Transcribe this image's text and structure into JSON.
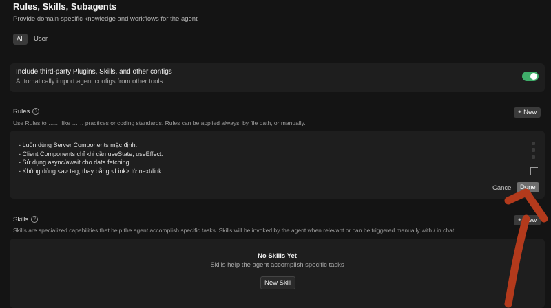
{
  "header": {
    "title": "Rules, Skills, Subagents",
    "subtitle": "Provide domain-specific knowledge and workflows for the agent"
  },
  "filters": [
    {
      "label": "All",
      "active": true
    },
    {
      "label": "User",
      "active": false
    }
  ],
  "third_party": {
    "title": "Include third-party Plugins, Skills, and other configs",
    "description": "Automatically import agent configs from other tools",
    "enabled": true,
    "toggle_color": "#3fae6a"
  },
  "rules": {
    "title": "Rules",
    "description": "Use Rules to …… like …… practices or coding standards. Rules can be applied always, by file path, or manually.",
    "new_button": "+ New",
    "lines": [
      "- Luôn dùng Server Components mặc định.",
      "- Client Components chỉ khi cần useState, useEffect.",
      "- Sử dụng async/await cho data fetching.",
      "- Không dùng <a> tag, thay bằng <Link> từ next/link."
    ],
    "cancel_label": "Cancel",
    "done_label": "Done"
  },
  "skills": {
    "title": "Skills",
    "description": "Skills are specialized capabilities that help the agent accomplish specific tasks. Skills will be invoked by the agent when relevant or can be triggered manually with / in chat.",
    "new_button": "+ New",
    "empty_title": "No Skills Yet",
    "empty_description": "Skills help the agent accomplish specific tasks",
    "new_skill_button": "New Skill"
  },
  "annotation": {
    "arrow_color": "#b33a1c"
  }
}
